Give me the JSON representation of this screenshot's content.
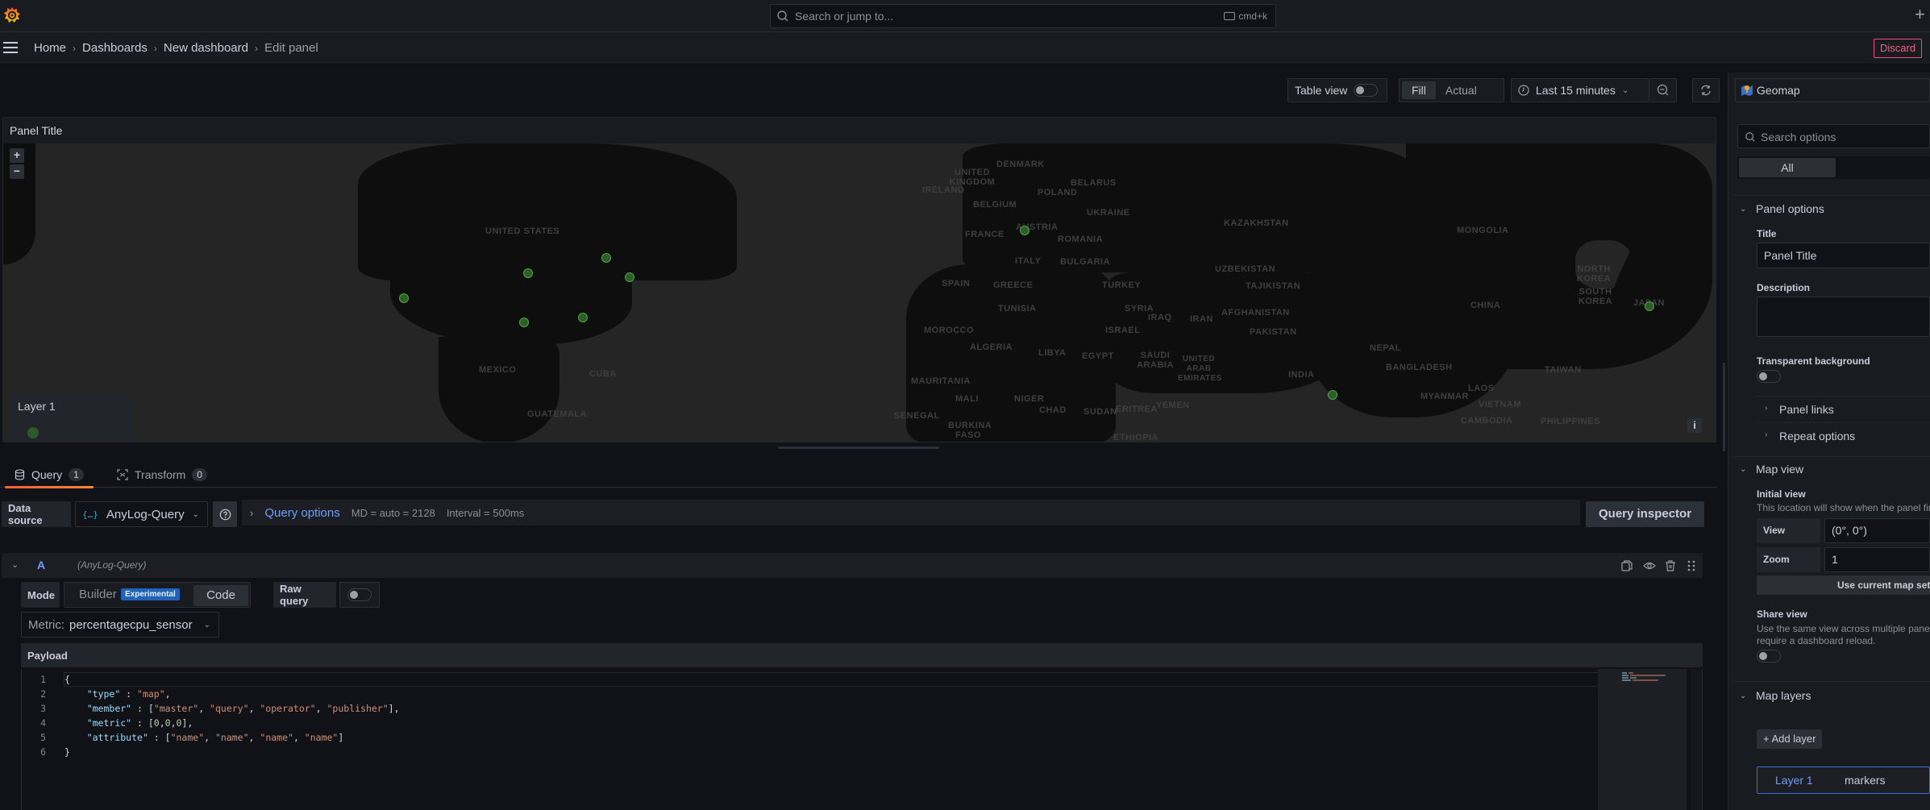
{
  "topbar": {
    "search_placeholder": "Search or jump to...",
    "shortcut": "cmd+k",
    "add_icon": "plus-icon"
  },
  "breadcrumb": {
    "items": [
      "Home",
      "Dashboards",
      "New dashboard"
    ],
    "current": "Edit panel"
  },
  "header_actions": {
    "discard_label": "Discard"
  },
  "toolbar": {
    "table_view_label": "Table view",
    "table_view_on": false,
    "fill_label": "Fill",
    "actual_label": "Actual",
    "selected_fit": "Fill",
    "time_range": "Last 15 minutes",
    "icons": [
      "clock-icon",
      "zoom-out-icon",
      "refresh-icon"
    ]
  },
  "panel": {
    "title": "Panel Title",
    "zoom_in": "+",
    "zoom_out": "−",
    "info": "i",
    "legend": {
      "layer_name": "Layer 1",
      "marker_color": "#2d5a2a"
    },
    "map": {
      "marker_color": "#4da63f",
      "markers": [
        {
          "near": "San Francisco, US"
        },
        {
          "near": "Minneapolis, US"
        },
        {
          "near": "Toronto, CA"
        },
        {
          "near": "New York, US"
        },
        {
          "near": "Dallas, US"
        },
        {
          "near": "Atlanta, US"
        },
        {
          "near": "Frankfurt, DE"
        },
        {
          "near": "Mumbai, IN"
        },
        {
          "near": "Tokyo, JP"
        }
      ],
      "country_labels": [
        "UNITED STATES",
        "MEXICO",
        "CUBA",
        "GUATEMALA",
        "UNITED KINGDOM",
        "IRELAND",
        "DENMARK",
        "BELGIUM",
        "BELARUS",
        "POLAND",
        "UKRAINE",
        "FRANCE",
        "AUSTRIA",
        "ROMANIA",
        "ITALY",
        "BULGARIA",
        "SPAIN",
        "GREECE",
        "TURKEY",
        "KAZAKHSTAN",
        "UZBEKISTAN",
        "TAJIKISTAN",
        "MONGOLIA",
        "CHINA",
        "NORTH KOREA",
        "SOUTH KOREA",
        "JAPAN",
        "NEPAL",
        "BANGLADESH",
        "TAIWAN",
        "LAOS",
        "MYANMAR",
        "VIETNAM",
        "CAMBODIA",
        "PHILIPPINES",
        "TUNISIA",
        "MOROCCO",
        "ALGERIA",
        "LIBYA",
        "EGYPT",
        "SYRIA",
        "IRAQ",
        "IRAN",
        "ISRAEL",
        "AFGHANISTAN",
        "PAKISTAN",
        "SAUDI ARABIA",
        "UNITED ARAB EMIRATES",
        "INDIA",
        "MAURITANIA",
        "MALI",
        "NIGER",
        "CHAD",
        "SUDAN",
        "ERITREA",
        "YEMEN",
        "SENEGAL",
        "BURKINA FASO",
        "ETHIOPIA"
      ]
    }
  },
  "editor_tabs": [
    {
      "label": "Query",
      "count": "1",
      "active": true,
      "icon": "database-icon"
    },
    {
      "label": "Transform",
      "count": "0",
      "active": false,
      "icon": "transform-icon"
    }
  ],
  "datasource": {
    "label": "Data source",
    "selected": "AnyLog-Query",
    "query_options_label": "Query options",
    "md": "MD = auto = 2128",
    "interval": "Interval = 500ms",
    "inspector_label": "Query inspector"
  },
  "query_a": {
    "ref_id": "A",
    "datasource": "(AnyLog-Query)",
    "mode_label": "Mode",
    "builder_label": "Builder",
    "experimental_badge": "Experimental",
    "code_label": "Code",
    "selected_mode": "Code",
    "raw_query_label": "Raw query",
    "raw_query_on": false,
    "metric_prefix": "Metric:",
    "metric_value": "percentagecpu_sensor",
    "payload_label": "Payload",
    "payload_lines": [
      "{",
      "    \"type\" : \"map\",",
      "    \"member\" : [\"master\", \"query\", \"operator\", \"publisher\"],",
      "    \"metric\" : [0,0,0],",
      "    \"attribute\" : [\"name\", \"name\", \"name\", \"name\"]",
      "}"
    ]
  },
  "options_pane": {
    "visualization": "Geomap",
    "search_placeholder": "Search options",
    "filter_tab": "All",
    "panel_options": {
      "title": "Panel options",
      "title_label": "Title",
      "title_value": "Panel Title",
      "description_label": "Description",
      "description_value": "",
      "transparent_label": "Transparent background",
      "transparent_on": false,
      "panel_links": "Panel links",
      "repeat_options": "Repeat options"
    },
    "map_view": {
      "title": "Map view",
      "initial_view_label": "Initial view",
      "initial_view_desc": "This location will show when the panel first loads.",
      "view_label": "View",
      "view_value": "(0°, 0°)",
      "zoom_label": "Zoom",
      "zoom_value": "1",
      "use_current_label": "Use current map settings",
      "share_view_label": "Share view",
      "share_view_desc_1": "Use the same view across multiple panels. Note: this may",
      "share_view_desc_2": "require a dashboard reload.",
      "share_view_on": false
    },
    "map_layers": {
      "title": "Map layers",
      "add_layer_label": "Add layer",
      "layers": [
        {
          "name": "Layer 1",
          "type": "markers"
        }
      ]
    }
  }
}
